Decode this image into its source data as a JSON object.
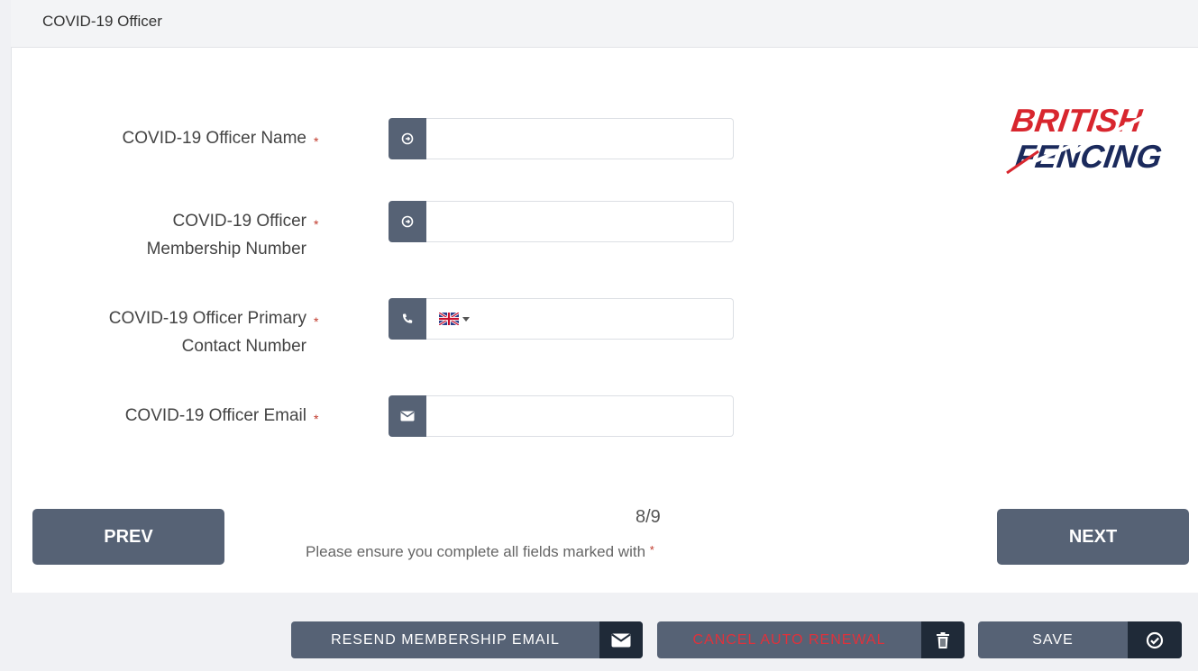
{
  "header": {
    "title": "COVID-19 Officer"
  },
  "fields": [
    {
      "label_line1": "COVID-19 Officer Name",
      "label_line2": "",
      "icon": "arrow-circle-icon",
      "value": "",
      "placeholder": ""
    },
    {
      "label_line1": "COVID-19 Officer",
      "label_line2": "Membership Number",
      "icon": "arrow-circle-icon",
      "value": "",
      "placeholder": ""
    },
    {
      "label_line1": "COVID-19 Officer Primary",
      "label_line2": "Contact Number",
      "icon": "phone-icon",
      "value": "",
      "placeholder": "",
      "country_flag": "uk-flag-icon"
    },
    {
      "label_line1": "COVID-19 Officer Email",
      "label_line2": "",
      "icon": "envelope-icon",
      "value": "",
      "placeholder": ""
    }
  ],
  "required_marker": "*",
  "logo": {
    "line1": "BRITISH",
    "line2": "FENCING",
    "red": "#d8262e",
    "blue": "#1b2a5c"
  },
  "nav": {
    "prev_label": "PREV",
    "next_label": "NEXT",
    "step": "8/9",
    "note": "Please ensure you complete all fields marked with"
  },
  "footer": {
    "resend_label": "RESEND MEMBERSHIP EMAIL",
    "cancel_label": "CANCEL AUTO RENEWAL",
    "save_label": "SAVE"
  },
  "colors": {
    "accent": "#566275",
    "dark": "#1f2a38",
    "danger": "#e0313b"
  }
}
